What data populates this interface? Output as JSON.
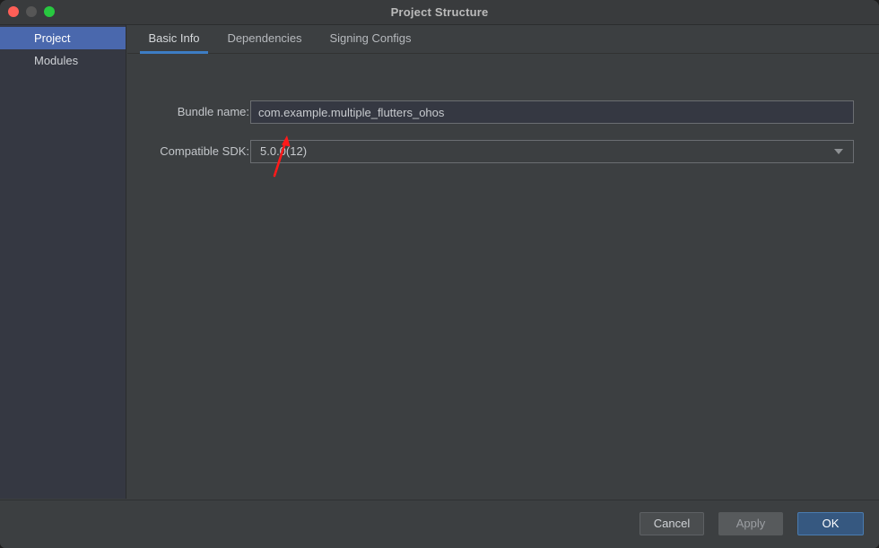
{
  "window": {
    "title": "Project Structure",
    "controls": [
      {
        "name": "close",
        "color": "#ff5f57"
      },
      {
        "name": "minimize",
        "color": "#565656"
      },
      {
        "name": "zoom",
        "color": "#28c840"
      }
    ]
  },
  "sidebar": {
    "items": [
      {
        "label": "Project",
        "selected": true
      },
      {
        "label": "Modules",
        "selected": false
      }
    ]
  },
  "tabs": [
    {
      "label": "Basic Info",
      "active": true
    },
    {
      "label": "Dependencies",
      "active": false
    },
    {
      "label": "Signing Configs",
      "active": false
    }
  ],
  "form": {
    "bundle": {
      "label": "Bundle name:",
      "value": "com.example.multiple_flutters_ohos",
      "placeholder": ""
    },
    "sdk": {
      "label": "Compatible SDK:",
      "value": "5.0.0(12)",
      "arrow_icon": "chevron-down-icon"
    }
  },
  "annotation": {
    "type": "arrow",
    "color": "#ff1a1a",
    "points_to": "compatible-sdk-combobox"
  },
  "footer": {
    "cancel_label": "Cancel",
    "apply_label": "Apply",
    "ok_label": "OK"
  },
  "colors": {
    "window_bg": "#3c3f41",
    "titlebar_bg": "#393b3d",
    "sidebar_bg": "#353842",
    "selection_blue": "#4a68ad",
    "tab_underline": "#3d7dc4",
    "ok_button": "#365880",
    "input_bg": "#353842",
    "text": "#c8cbcf",
    "annotation_red": "#ff1a1a"
  }
}
